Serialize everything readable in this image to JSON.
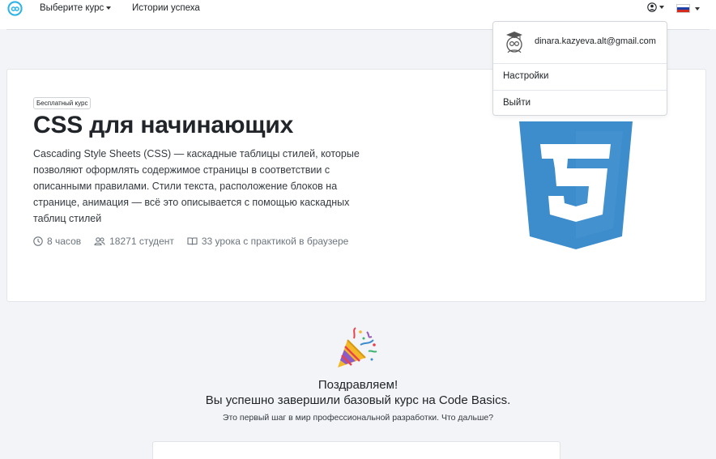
{
  "nav": {
    "choose_course": "Выберите курс",
    "success_stories": "Истории успеха"
  },
  "user_menu": {
    "email": "dinara.kazyeva.alt@gmail.com",
    "settings": "Настройки",
    "logout": "Выйти"
  },
  "course": {
    "badge": "Бесплатный курс",
    "title": "CSS для начинающих",
    "description": "Cascading Style Sheets (CSS) — каскадные таблицы стилей, которые позволяют оформлять содержимое страницы в соответствии с описанными правилами. Стили текста, расположение блоков на странице, анимация — всё это описывается с помощью каскадных таблиц стилей",
    "duration": "8 часов",
    "students": "18271 студент",
    "lessons": "33 урока с практикой в браузере",
    "logo_color": "#3d8ccc"
  },
  "congrats": {
    "title": "Поздравляем!",
    "subtitle": "Вы успешно завершили базовый курс на Code Basics.",
    "note": "Это первый шаг в мир профессиональной разработки. Что дальше?"
  },
  "colors": {
    "page_background": "#f3f4f7",
    "brand": "#2fb4e5",
    "flag": [
      "#ffffff",
      "#1c3fa8",
      "#d52b1e"
    ]
  }
}
